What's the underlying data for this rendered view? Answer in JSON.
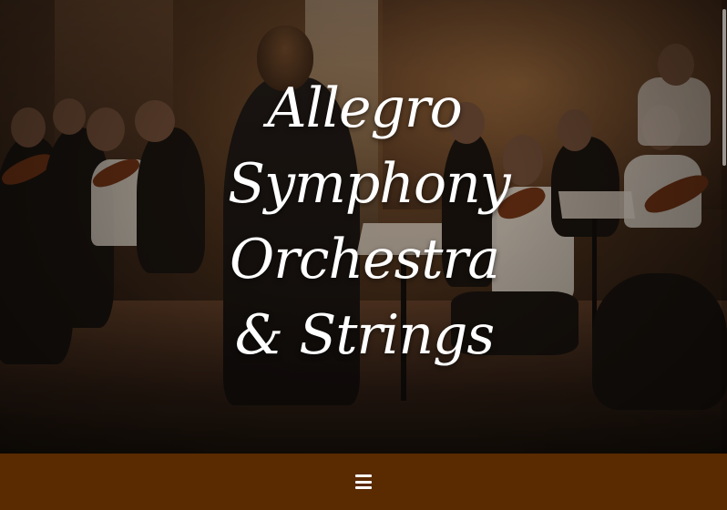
{
  "hero": {
    "title": "Allegro Symphony Orchestra & Strings",
    "image_alt_icon": "orchestra-photo"
  },
  "navbar": {
    "menu_icon": "hamburger-menu-icon",
    "background_color": "#5a2a00"
  }
}
